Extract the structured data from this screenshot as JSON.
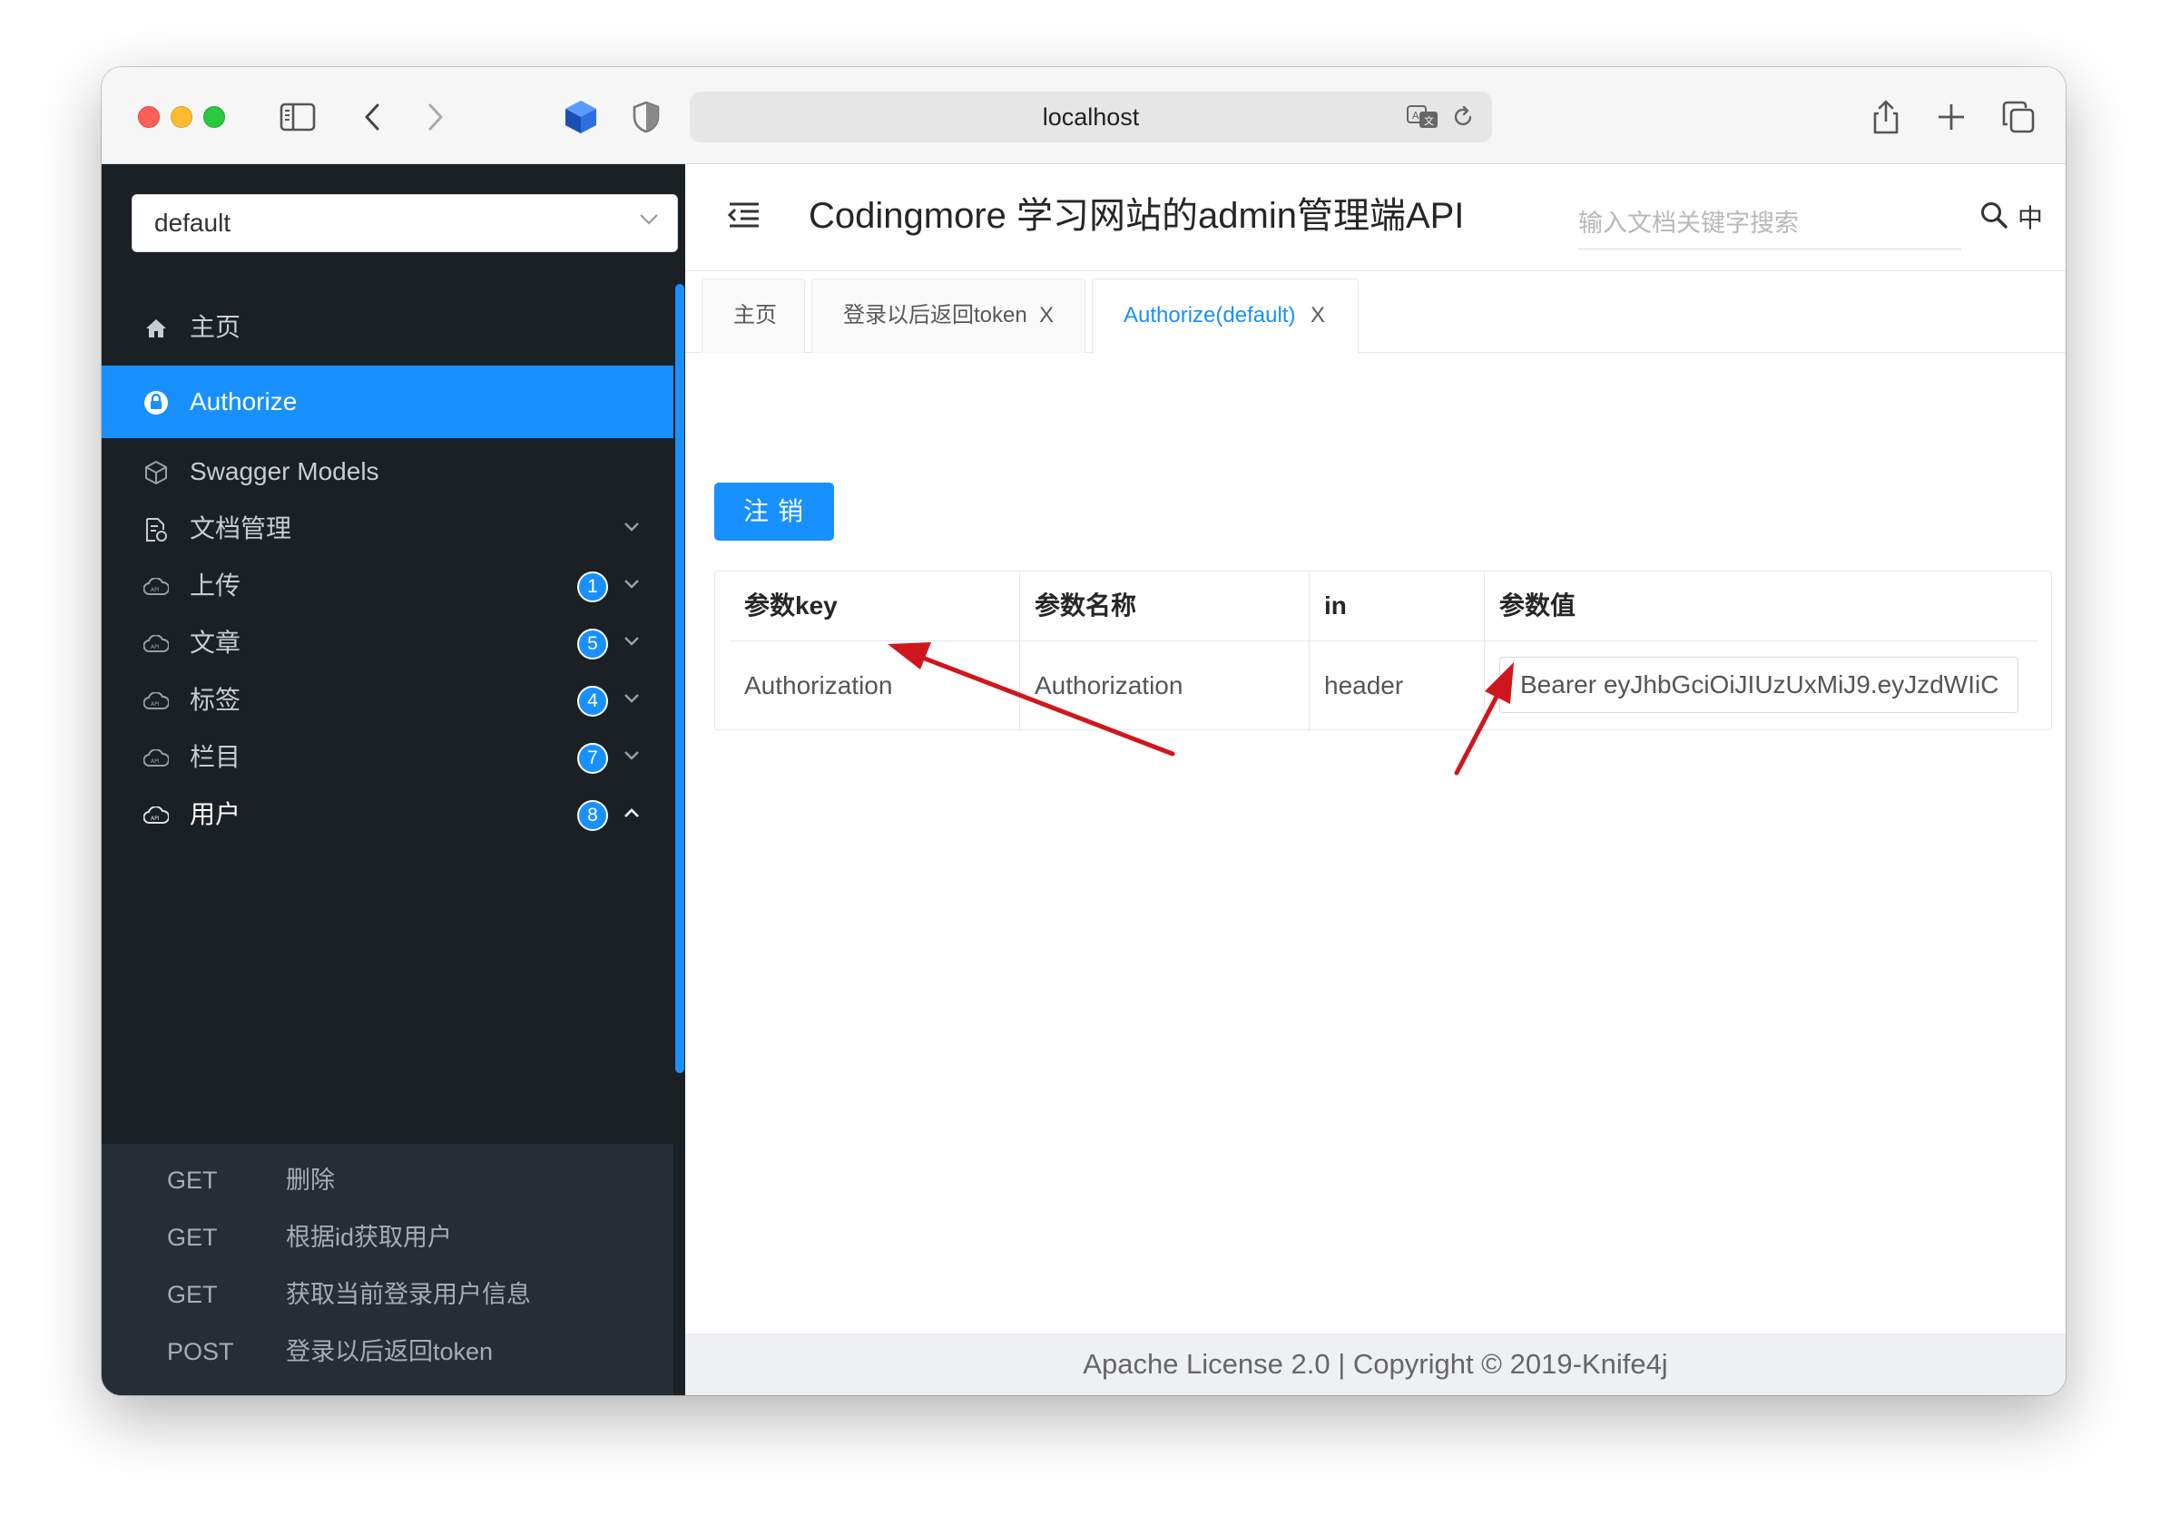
{
  "browser": {
    "url": "localhost"
  },
  "sidebar": {
    "group_select": "default",
    "items": [
      {
        "label": "主页",
        "icon": "home-icon"
      },
      {
        "label": "Authorize",
        "icon": "lock-icon",
        "active": true
      },
      {
        "label": "Swagger Models",
        "icon": "cube-icon"
      },
      {
        "label": "文档管理",
        "icon": "document-settings-icon"
      },
      {
        "label": "上传",
        "icon": "api-cloud-icon",
        "badge": "1"
      },
      {
        "label": "文章",
        "icon": "api-cloud-icon",
        "badge": "5"
      },
      {
        "label": "标签",
        "icon": "api-cloud-icon",
        "badge": "4"
      },
      {
        "label": "栏目",
        "icon": "api-cloud-icon",
        "badge": "7"
      },
      {
        "label": "用户",
        "icon": "api-cloud-icon",
        "badge": "8",
        "expanded": true
      }
    ],
    "sub_items": [
      {
        "method": "GET",
        "label": "删除"
      },
      {
        "method": "GET",
        "label": "根据id获取用户"
      },
      {
        "method": "GET",
        "label": "获取当前登录用户信息"
      },
      {
        "method": "POST",
        "label": "登录以后返回token"
      }
    ]
  },
  "header": {
    "title": "Codingmore 学习网站的admin管理端API",
    "search_placeholder": "输入文档关键字搜索",
    "lang": "中"
  },
  "tabs": [
    {
      "label": "主页",
      "closable": false
    },
    {
      "label": "登录以后返回token",
      "closable": true
    },
    {
      "label": "Authorize(default)",
      "closable": true,
      "active": true
    }
  ],
  "close_glyph": "X",
  "auth": {
    "logout_button": "注销",
    "columns": [
      "参数key",
      "参数名称",
      "in",
      "参数值"
    ],
    "row": {
      "key": "Authorization",
      "name": "Authorization",
      "in": "header",
      "value": "Bearer eyJhbGciOiJIUzUxMiJ9.eyJzdWIiC"
    }
  },
  "footer": "Apache License 2.0 | Copyright © 2019-Knife4j",
  "colors": {
    "accent": "#1890ff",
    "sidebar_bg": "#1b2025",
    "submenu_bg": "#262d34",
    "annotation_arrow": "#d0161d"
  }
}
